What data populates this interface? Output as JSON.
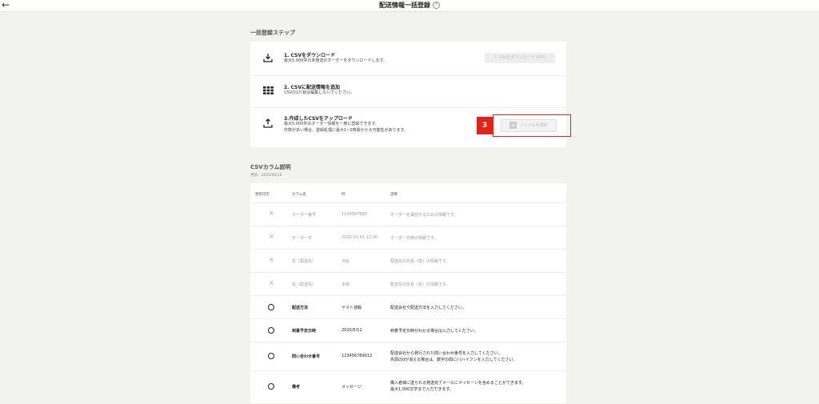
{
  "header": {
    "title": "配送情報一括登録",
    "help_icon": "?"
  },
  "steps_section": {
    "title": "一括登録ステップ"
  },
  "steps": [
    {
      "title": "1. CSVをダウンロード",
      "desc": "最大5,000件の未発送のオーダーをダウンロードします。",
      "icon": "download-icon",
      "button": "CSVをダウンロード (0件)"
    },
    {
      "title": "2. CSVに配送情報を追加",
      "desc": "CSVの1行目は編集しないでください。",
      "icon": "grid-icon"
    },
    {
      "title": "3.作成したCSVをアップロード",
      "desc1": "最大5,000件のオーダー情報を一度に登録できます。",
      "desc2": "件数が多い場合、登録処理に最大1~2時間かかる可能性があります。",
      "icon": "upload-icon",
      "button": "ファイルを選択",
      "badge": "3"
    }
  ],
  "columns_section": {
    "title": "CSVカラム説明",
    "updated": "更新：2020/06/16"
  },
  "table": {
    "headers": [
      "更新可否",
      "カラム名",
      "例",
      "説明"
    ],
    "rows": [
      {
        "mark": "×",
        "name": "オーダー番号",
        "example": "1234567890",
        "desc": "オーダーを識別するための情報です。",
        "editable": false
      },
      {
        "mark": "×",
        "name": "オーダー日",
        "example": "2020-01-01 12:00",
        "desc": "オーダー日時の情報です。",
        "editable": false
      },
      {
        "mark": "×",
        "name": "氏（配送先）",
        "example": "渋谷",
        "desc": "配送先の氏名（姓）の情報です。",
        "editable": false
      },
      {
        "mark": "×",
        "name": "名（配送先）",
        "example": "太郎",
        "desc": "配送先の氏名（名）の情報です。",
        "editable": false
      },
      {
        "mark": "○",
        "name": "配送方法",
        "example": "ヤマト運輸",
        "desc": "配送会社や配送方法を入力してください。",
        "editable": true
      },
      {
        "mark": "○",
        "name": "到着予定日時",
        "example": "2020/5/12",
        "desc": "到着予定日時がわかる場合は入力してください。",
        "editable": true
      },
      {
        "mark": "○",
        "name": "問い合わせ番号",
        "example": "123456789012",
        "desc": "配送会社から発行された問い合わせ番号を入力してください。",
        "desc2": "先頭の0が消える場合は、数字の間に(-)ハイフンを入力してください。",
        "editable": true
      },
      {
        "mark": "○",
        "name": "備考",
        "example": "メッセージ",
        "desc": "購入者様に送られる発送完了メールにメッセージを含めることができます。",
        "desc2": "最大1,000文字まで入力できます。",
        "editable": true
      }
    ]
  }
}
